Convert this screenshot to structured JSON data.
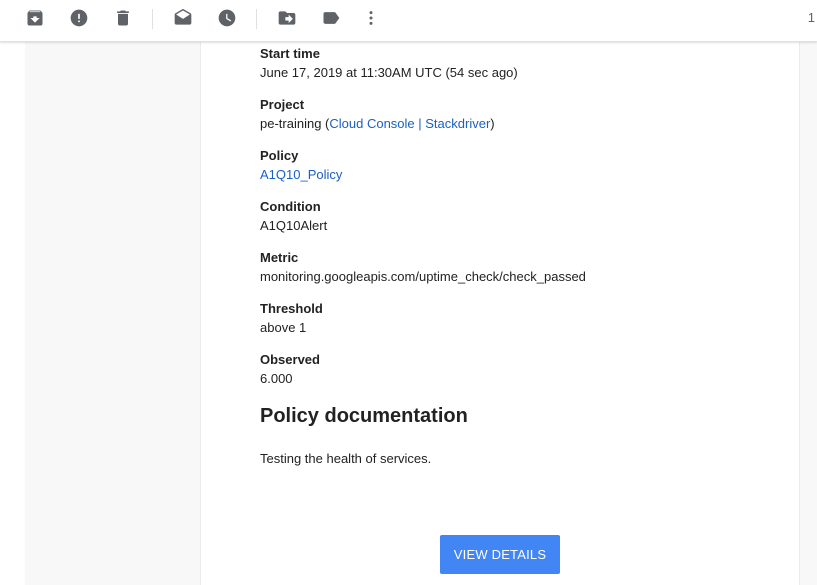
{
  "toolbar": {
    "icons": [
      "archive-icon",
      "report-spam-icon",
      "delete-icon",
      "mark-unread-icon",
      "snooze-icon",
      "move-to-icon",
      "label-icon",
      "more-icon"
    ],
    "page_count": "1"
  },
  "fields": [
    {
      "label": "Start time",
      "value": "June 17, 2019 at 11:30AM UTC (54 sec ago)"
    },
    {
      "label": "Project",
      "value_prefix": "pe-training (",
      "link_console": "Cloud Console",
      "separator": " | ",
      "link_stackdriver": "Stackdriver",
      "value_suffix": ")"
    },
    {
      "label": "Policy",
      "link": "A1Q10_Policy"
    },
    {
      "label": "Condition",
      "value": "A1Q10Alert"
    },
    {
      "label": "Metric",
      "value": "monitoring.googleapis.com/uptime_check/check_passed"
    },
    {
      "label": "Threshold",
      "value": "above 1"
    },
    {
      "label": "Observed",
      "value": "6.000"
    }
  ],
  "documentation": {
    "heading": "Policy documentation",
    "text": "Testing the health of services."
  },
  "button": {
    "label": "VIEW DETAILS"
  },
  "colors": {
    "link": "#1a5fc6",
    "button": "#4285f4",
    "icon": "#5f6368"
  }
}
